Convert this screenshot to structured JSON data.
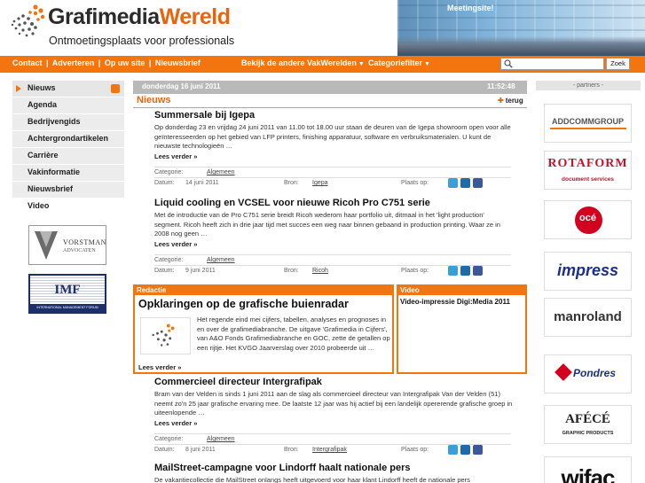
{
  "header": {
    "logo_part1": "Grafimedia",
    "logo_part2": "Wereld",
    "tagline": "Ontmoetingsplaats voor professionals",
    "banner_text": "Meetingsite!"
  },
  "nav": {
    "left_links": [
      "Contact",
      "Adverteren",
      "Op uw site",
      "Nieuwsbrief"
    ],
    "separator": "|",
    "vakwerelden": "Bekijk de andere VakWerelden",
    "categoriefilter": "Categoriefilter",
    "search_placeholder": "",
    "search_button": "Zoek"
  },
  "sidebar": {
    "items": [
      {
        "label": "Nieuws",
        "active": true
      },
      {
        "label": "Agenda"
      },
      {
        "label": "Bedrijvengids"
      },
      {
        "label": "Achtergrondartikelen"
      },
      {
        "label": "Carrière"
      },
      {
        "label": "Vakinformatie"
      },
      {
        "label": "Nieuwsbrief"
      },
      {
        "label": "Video"
      }
    ],
    "ads": [
      {
        "name": "VORSTMAN",
        "sub": "ADVOCATEN"
      },
      {
        "name": "IMF",
        "sub": "INTERNATIONAL MANAGEMENT FORUM"
      }
    ]
  },
  "main": {
    "date": "donderdag 16 juni 2011",
    "time": "11:52:48",
    "section": "Nieuws",
    "back": "terug",
    "labels": {
      "category": "Categorie:",
      "date": "Datum:",
      "source": "Bron:",
      "place": "Plaats op:",
      "more": "Lees verder »"
    },
    "articles": [
      {
        "title": "Summersale bij Igepa",
        "body": "Op donderdag 23 en vrijdag 24 juni 2011 van 11.00 tot 18.00 uur staan de deuren van de Igepa showroom open voor alle geïnteresseerden op het gebied van LFP printers, finishing apparatuur, software en verbruiksmaterialen. U kunt de nieuwste technologieën …",
        "category": "Algemeen",
        "date": "14 juni 2011",
        "source": "Igepa"
      },
      {
        "title": "Liquid cooling en VCSEL voor nieuwe Ricoh Pro C751 serie",
        "body": "Met de introductie van de Pro C751 serie breidt Ricoh wederom haar portfolio uit, ditmaal in het 'light production' segment. Ricoh heeft zich in drie jaar tijd met succes een weg naar binnen gebaand in production printing. Waar ze in 2008 nog geen …",
        "category": "Algemeen",
        "date": "9 juni 2011",
        "source": "Ricoh"
      },
      {
        "title": "Commercieel directeur Intergrafipak",
        "body": "Bram van der Velden is sinds 1 juni 2011 aan de slag als commercieel directeur van Intergrafipak Van der Velden (51) neemt zo'n 25 jaar grafische ervaring mee. De laatste 12 jaar was hij actief bij een landelijk opererende grafische groep in uiteenlopende …",
        "category": "Algemeen",
        "date": "8 juni 2011",
        "source": "Intergrafipak"
      },
      {
        "title": "MailStreet-campagne voor Lindorff haalt nationale pers",
        "body": "De vakantiecollectie die MailStreet onlangs heeft uitgevoerd voor haar klant Lindorff heeft de nationale pers",
        "category": "",
        "date": "",
        "source": ""
      }
    ],
    "redactie": {
      "header": "Redactie",
      "title": "Opklaringen op de grafische buienradar",
      "body": "Het regende eind mei cijfers, tabellen, analyses en prognoses in en over de grafimediabranche. De uitgave 'Grafimedia in Cijfers', van A&O Fonds Grafimediabranche en GOC, zette de getallen op een rijtje. Het KVGO Jaarverslag over 2010 probeerde uit …",
      "more": "Lees verder »"
    },
    "video": {
      "header": "Video",
      "title": "Video-impressie Digi:Media 2011"
    }
  },
  "partners": {
    "header": "- partners -",
    "items": [
      {
        "name": "ADDCOMMGROUP"
      },
      {
        "name": "ROTAFORM",
        "sub": "document services"
      },
      {
        "name": "océ"
      },
      {
        "name": "impress"
      },
      {
        "name": "manroland"
      },
      {
        "name": "Pondres"
      },
      {
        "name": "AFÉCÉ",
        "sub": "GRAPHIC PRODUCTS"
      },
      {
        "name": "wifac"
      }
    ]
  },
  "colors": {
    "accent": "#f2750f",
    "gray_bar": "#b9b9b9"
  }
}
